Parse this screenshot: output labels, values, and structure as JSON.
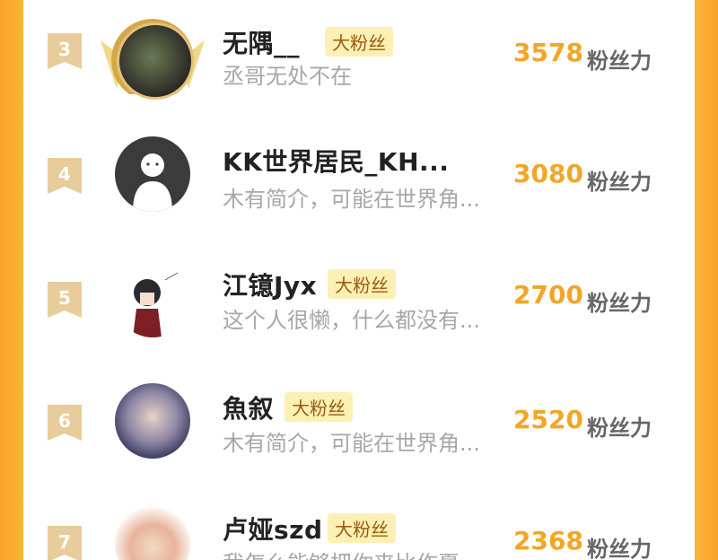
{
  "colors": {
    "accent": "#f2a626",
    "frame": "#fbb437",
    "badge_bg": "#fdf0b4",
    "rank_tag": "#e8cc9c"
  },
  "rows": [
    {
      "rank": "3",
      "name": "无隅__",
      "badge": "大粉丝",
      "bio": "丞哥无处不在",
      "score": "3578",
      "unit": "粉丝力",
      "avatar": "crown-avatar"
    },
    {
      "rank": "4",
      "name": "KK世界居民_KH...",
      "badge": "",
      "bio": "木有简介，可能在世界角...",
      "score": "3080",
      "unit": "粉丝力",
      "avatar": "default-avatar"
    },
    {
      "rank": "5",
      "name": "江镱Jyx",
      "badge": "大粉丝",
      "bio": "这个人很懒，什么都没有...",
      "score": "2700",
      "unit": "粉丝力",
      "avatar": "anime-avatar"
    },
    {
      "rank": "6",
      "name": "魚叙",
      "badge": "大粉丝",
      "bio": "木有简介，可能在世界角...",
      "score": "2520",
      "unit": "粉丝力",
      "avatar": "anime-avatar"
    },
    {
      "rank": "7",
      "name": "卢娅szd",
      "badge": "大粉丝",
      "bio": "我怎么能够把你来比作夏...",
      "score": "2368",
      "unit": "粉丝力",
      "avatar": "anime-avatar"
    }
  ]
}
